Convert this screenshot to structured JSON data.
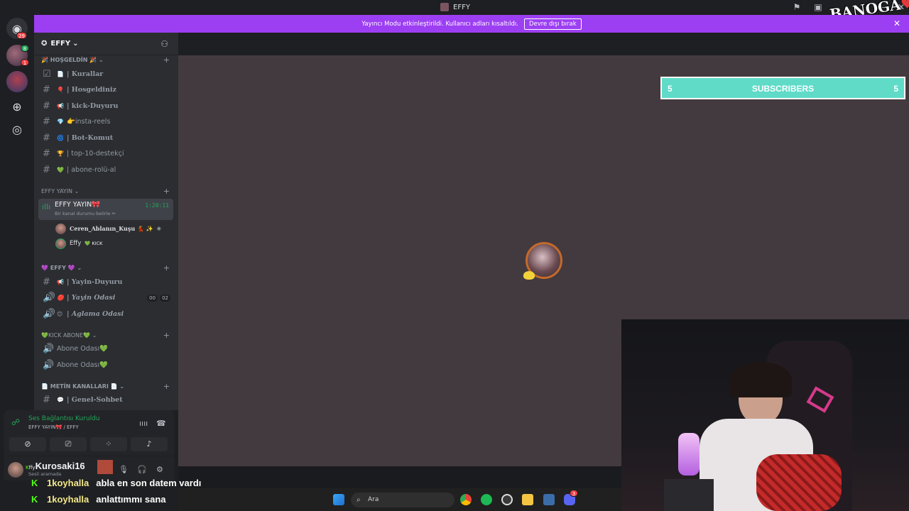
{
  "window": {
    "title": "EFFY"
  },
  "rail": {
    "dm_badge": "29",
    "server1_badge_top": "8",
    "server1_badge_bottom": "1"
  },
  "banner": {
    "text": "Yayıncı Modu etkinleştirildi. Kullanıcı adları kısaltıldı.",
    "button": "Devre dışı bırak"
  },
  "guild": {
    "name": "EFFY"
  },
  "channels": {
    "cat1": "HOŞGELDİN",
    "items1": [
      {
        "emo": "📄",
        "label": "| Kurallar"
      },
      {
        "emo": "🎈",
        "label": "| Hosgeldiniz"
      },
      {
        "emo": "📢",
        "label": "| kick-Duyuru"
      },
      {
        "emo": "💎",
        "label": "👉insta-reels"
      },
      {
        "emo": "🌀",
        "label": "| Bot-Komut"
      },
      {
        "emo": "🏆",
        "label": "| top-10-destekçi"
      },
      {
        "emo": "💚",
        "label": "| abone-rolü-al"
      }
    ],
    "cat2": "EFFY YAYIN",
    "voice_active": {
      "name": "EFFY YAYIN🎀",
      "sub": "Bir kanal durumu belirle ✏",
      "time": "1:20:11"
    },
    "voice_users": [
      {
        "name": "Ceren_Ablanın_Kuşu 💃 ✨"
      },
      {
        "name": "Effy",
        "tag": "💚 KICK"
      }
    ],
    "cat3": "💜 EFFY 💜",
    "items3": [
      {
        "emo": "📢",
        "label": "| Yayin-Duyuru"
      },
      {
        "emo": "🔴",
        "label": "| Yayin Odasi",
        "c1": "00",
        "c2": "02"
      },
      {
        "emo": "😊",
        "label": "| Aglama Odasi"
      }
    ],
    "cat4": "💚KICK ABONE💚",
    "items4": [
      {
        "label": "Abone Odası💚"
      },
      {
        "label": "Abone Odası💚"
      }
    ],
    "cat5": "📄 METİN KANALLARI 📄",
    "items5": [
      {
        "emo": "💬",
        "label": "| Genel-Sohbet"
      }
    ]
  },
  "voice_panel": {
    "status": "Ses Bağlantısı Kuruldu",
    "channel": "EFFY YAYIN🎀 / EFFY"
  },
  "user_panel": {
    "name": "Kurosaki16",
    "prefix": "ffy",
    "status": "Sesli aramada"
  },
  "stage": {
    "subscribers": {
      "left": "5",
      "label": "SUBSCRIBERS",
      "right": "5"
    }
  },
  "chat": [
    {
      "user": "1koyhalla",
      "msg": "abla en son datem vardı"
    },
    {
      "user": "1koyhalla",
      "msg": "anlattımmı sana"
    }
  ],
  "taskbar": {
    "search": "Ara",
    "discord_badge": "3"
  },
  "overlay_logo": "BANOGA"
}
